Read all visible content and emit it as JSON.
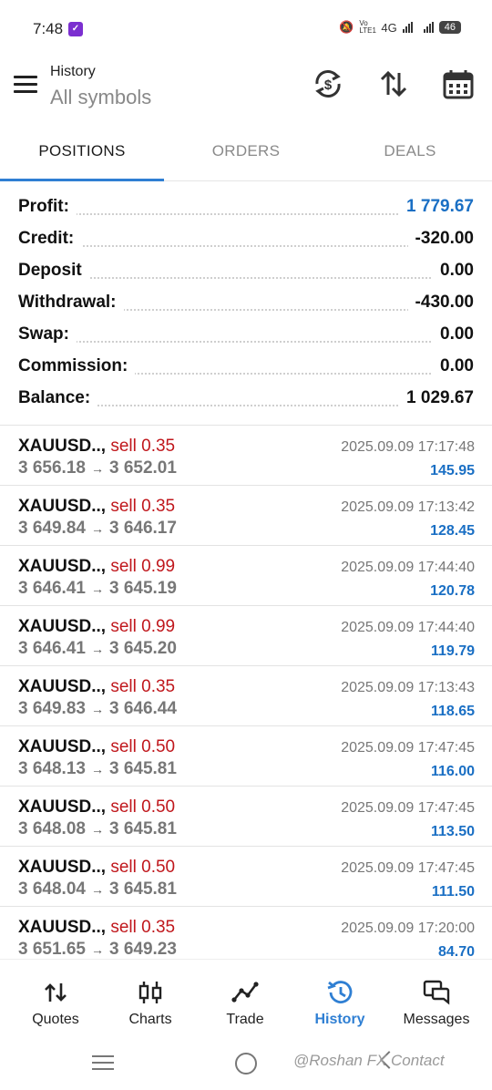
{
  "status_bar": {
    "time": "7:48",
    "network": "4G",
    "lte": "Vo LTE1",
    "battery": "46"
  },
  "header": {
    "title": "History",
    "subtitle": "All symbols"
  },
  "tabs": [
    {
      "label": "POSITIONS",
      "active": true
    },
    {
      "label": "ORDERS",
      "active": false
    },
    {
      "label": "DEALS",
      "active": false
    }
  ],
  "summary": [
    {
      "label": "Profit:",
      "value": "1 779.67",
      "color": "#1a6fc4"
    },
    {
      "label": "Credit:",
      "value": "-320.00"
    },
    {
      "label": "Deposit",
      "value": "0.00"
    },
    {
      "label": "Withdrawal:",
      "value": "-430.00"
    },
    {
      "label": "Swap:",
      "value": "0.00"
    },
    {
      "label": "Commission:",
      "value": "0.00"
    },
    {
      "label": "Balance:",
      "value": "1 029.67"
    }
  ],
  "deals": [
    {
      "symbol": "XAUUSD..,",
      "type": "sell 0.35",
      "open": "3 656.18",
      "close": "3 652.01",
      "time": "2025.09.09 17:17:48",
      "profit": "145.95"
    },
    {
      "symbol": "XAUUSD..,",
      "type": "sell 0.35",
      "open": "3 649.84",
      "close": "3 646.17",
      "time": "2025.09.09 17:13:42",
      "profit": "128.45"
    },
    {
      "symbol": "XAUUSD..,",
      "type": "sell 0.99",
      "open": "3 646.41",
      "close": "3 645.19",
      "time": "2025.09.09 17:44:40",
      "profit": "120.78"
    },
    {
      "symbol": "XAUUSD..,",
      "type": "sell 0.99",
      "open": "3 646.41",
      "close": "3 645.20",
      "time": "2025.09.09 17:44:40",
      "profit": "119.79"
    },
    {
      "symbol": "XAUUSD..,",
      "type": "sell 0.35",
      "open": "3 649.83",
      "close": "3 646.44",
      "time": "2025.09.09 17:13:43",
      "profit": "118.65"
    },
    {
      "symbol": "XAUUSD..,",
      "type": "sell 0.50",
      "open": "3 648.13",
      "close": "3 645.81",
      "time": "2025.09.09 17:47:45",
      "profit": "116.00"
    },
    {
      "symbol": "XAUUSD..,",
      "type": "sell 0.50",
      "open": "3 648.08",
      "close": "3 645.81",
      "time": "2025.09.09 17:47:45",
      "profit": "113.50"
    },
    {
      "symbol": "XAUUSD..,",
      "type": "sell 0.50",
      "open": "3 648.04",
      "close": "3 645.81",
      "time": "2025.09.09 17:47:45",
      "profit": "111.50"
    },
    {
      "symbol": "XAUUSD..,",
      "type": "sell 0.35",
      "open": "3 651.65",
      "close": "3 649.23",
      "time": "2025.09.09 17:20:00",
      "profit": "84.70"
    }
  ],
  "arrow": "→",
  "bottom_nav": [
    {
      "label": "Quotes",
      "icon": "quotes-icon"
    },
    {
      "label": "Charts",
      "icon": "charts-icon"
    },
    {
      "label": "Trade",
      "icon": "trade-icon"
    },
    {
      "label": "History",
      "icon": "history-icon",
      "active": true
    },
    {
      "label": "Messages",
      "icon": "messages-icon"
    }
  ],
  "watermark": "@Roshan FX Contact",
  "colors": {
    "accent": "#2f7fd3",
    "profit_blue": "#1a6fc4",
    "sell_red": "#c0171c"
  }
}
